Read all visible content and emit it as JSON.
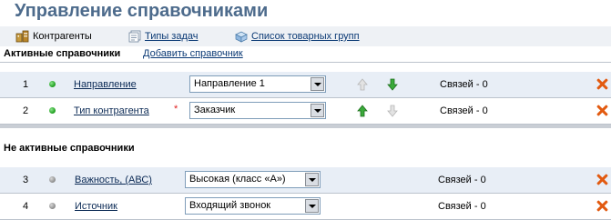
{
  "page": {
    "title": "Управление справочниками"
  },
  "toolbar": {
    "items": [
      {
        "label": "Контрагенты",
        "icon": "building-icon"
      },
      {
        "label": "Типы задач",
        "icon": "tasks-icon"
      },
      {
        "label": "Список товарных групп",
        "icon": "boxes-icon"
      }
    ]
  },
  "active": {
    "header": "Активные справочники",
    "add_link": "Добавить справочник",
    "rows": [
      {
        "num": "1",
        "name": "Направление",
        "required": "",
        "selected": "Направление 1",
        "links": "Связей - 0"
      },
      {
        "num": "2",
        "name": "Тип контрагента",
        "required": "*",
        "selected": "Заказчик",
        "links": "Связей - 0"
      }
    ]
  },
  "inactive": {
    "header": "Не активные справочники",
    "rows": [
      {
        "num": "3",
        "name": "Важность, (АВС)",
        "selected": "Высокая (класс «А»)",
        "links": "Связей - 0"
      },
      {
        "num": "4",
        "name": "Источник",
        "selected": "Входящий звонок",
        "links": "Связей - 0"
      }
    ]
  },
  "colors": {
    "title": "#4d6b8c",
    "link": "#0b3a75",
    "row_tint": "#e8eef6",
    "arrow_active": "#2a9a2a",
    "arrow_disabled": "#c8c8c8",
    "delete": "#e25a10",
    "status_active": "#1a9a1a",
    "status_inactive": "#8a8a8a"
  }
}
